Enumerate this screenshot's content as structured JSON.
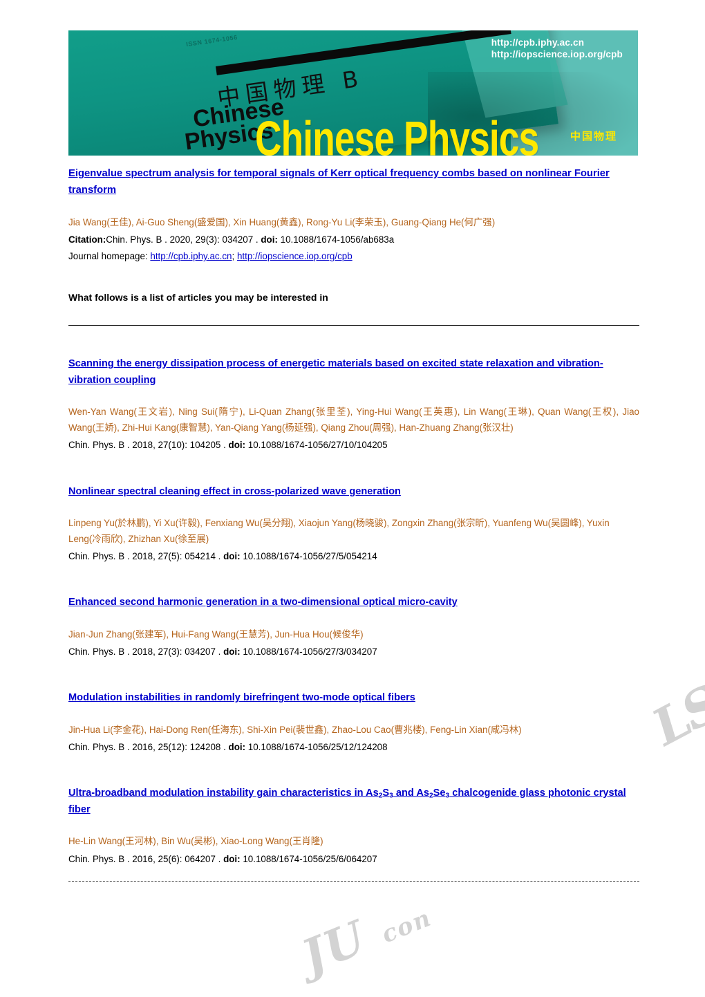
{
  "banner": {
    "issn": "ISSN 1674-1056",
    "cover_cn_title": "中国物理 B",
    "cover_en_line1": "Chinese",
    "cover_en_line2": "Physics",
    "url_line1": "http://cpb.iphy.ac.cn",
    "url_line2": "http://iopscience.iop.org/cpb",
    "cn_small": "中国物理",
    "wordmark": "Chinese Physics",
    "wordmark_b": "B"
  },
  "watermarks": {
    "right": "LS",
    "bottom": "JU",
    "bottom_small": "con"
  },
  "lead_article": {
    "title": "Eigenvalue spectrum analysis for temporal signals of Kerr optical frequency combs based on nonlinear Fourier transform",
    "authors": "Jia Wang(王佳), Ai-Guo Sheng(盛爱国), Xin Huang(黄鑫), Rong-Yu Li(李荣玉), Guang-Qiang He(何广强)",
    "citation_label": "Citation:",
    "citation_text": "Chin. Phys. B . 2020, 29(3): 034207 . ",
    "doi_label": "doi:",
    "doi_value": " 10.1088/1674-1056/ab683a",
    "homepage_label": "Journal homepage: ",
    "homepage_link1": "http://cpb.iphy.ac.cn",
    "homepage_sep": "; ",
    "homepage_link2": "http://iopscience.iop.org/cpb"
  },
  "section_note": "What follows is a list of articles you may be interested in",
  "related_articles": [
    {
      "title": "Scanning the energy dissipation process of energetic materials based on excited state relaxation and vibration-vibration coupling",
      "authors": "Wen-Yan Wang(王文岩), Ning Sui(隋宁), Li-Quan Zhang(张里荃), Ying-Hui Wang(王英惠), Lin Wang(王琳), Quan Wang(王权), Jiao Wang(王娇), Zhi-Hui Kang(康智慧), Yan-Qiang Yang(杨延强), Qiang Zhou(周强), Han-Zhuang Zhang(张汉壮)",
      "citation_text": "Chin. Phys. B . 2018, 27(10): 104205 . ",
      "doi_label": "doi:",
      "doi_value": " 10.1088/1674-1056/27/10/104205",
      "justify": true
    },
    {
      "title": "Nonlinear spectral cleaning effect in cross-polarized wave generation",
      "authors": "Linpeng Yu(於林鹏), Yi Xu(许毅), Fenxiang Wu(吴分翔), Xiaojun Yang(杨晓骏), Zongxin Zhang(张宗昕), Yuanfeng Wu(吴圆峰), Yuxin Leng(冷雨欣), Zhizhan Xu(徐至展)",
      "citation_text": "Chin. Phys. B . 2018, 27(5): 054214 . ",
      "doi_label": "doi:",
      "doi_value": " 10.1088/1674-1056/27/5/054214",
      "justify": false
    },
    {
      "title": "Enhanced second harmonic generation in a two-dimensional optical micro-cavity",
      "authors": "Jian-Jun Zhang(张建军), Hui-Fang Wang(王慧芳), Jun-Hua Hou(候俊华)",
      "citation_text": "Chin. Phys. B . 2018, 27(3): 034207 . ",
      "doi_label": "doi:",
      "doi_value": " 10.1088/1674-1056/27/3/034207",
      "justify": false
    },
    {
      "title": "Modulation instabilities in randomly birefringent two-mode optical fibers",
      "authors": "Jin-Hua Li(李金花), Hai-Dong Ren(任海东), Shi-Xin Pei(裴世鑫), Zhao-Lou Cao(曹兆楼), Feng-Lin Xian(咸冯林)",
      "citation_text": "Chin. Phys. B . 2016, 25(12): 124208 . ",
      "doi_label": "doi:",
      "doi_value": " 10.1088/1674-1056/25/12/124208",
      "justify": false
    }
  ],
  "last_article": {
    "title_part1": "Ultra-broadband modulation instability gain characteristics in As",
    "title_sub1": "2",
    "title_part2": "S",
    "title_sub2": "3",
    "title_part3": " and As",
    "title_sub3": "2",
    "title_part4": "Se",
    "title_sub4": "3",
    "title_part5": " chalcogenide glass photonic crystal fiber",
    "authors": "He-Lin Wang(王河林), Bin Wu(吴彬), Xiao-Long Wang(王肖隆)",
    "citation_text": "Chin. Phys. B . 2016, 25(6): 064207 . ",
    "doi_label": "doi:",
    "doi_value": " 10.1088/1674-1056/25/6/064207"
  },
  "colors": {
    "link": "#0000cc",
    "author": "#b5651d",
    "banner_dark_teal": "#0b9180",
    "banner_light_teal": "#5dbfb6",
    "wordmark_yellow": "#ffe800"
  }
}
